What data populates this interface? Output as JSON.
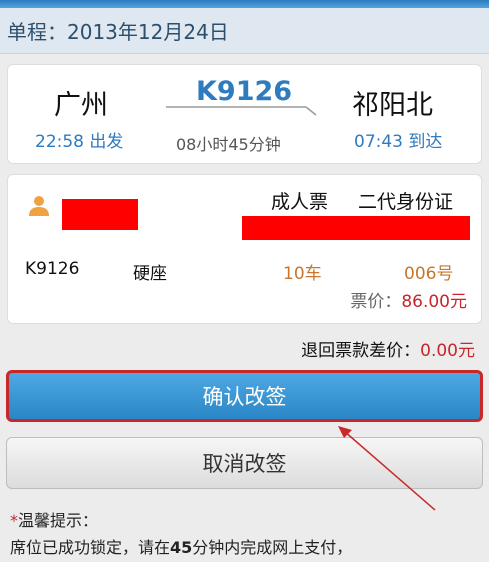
{
  "header": {
    "title": "单程：2013年12月24日"
  },
  "route": {
    "from_city": "广州",
    "to_city": "祁阳北",
    "train_number": "K9126",
    "departure": "22:58 出发",
    "arrival": "07:43 到达",
    "duration": "08小时45分钟"
  },
  "ticket": {
    "ticket_type": "成人票",
    "id_type": "二代身份证",
    "train_code": "K9126",
    "seat_class": "硬座",
    "coach": "10车",
    "seat_number": "006号",
    "price_label": "票价：",
    "price_value": "86.00元"
  },
  "refund": {
    "label": "退回票款差价：",
    "value": "0.00元"
  },
  "buttons": {
    "confirm": "确认改签",
    "cancel": "取消改签"
  },
  "tips": {
    "star": "*",
    "title": "温馨提示：",
    "line_pre": "席位已成功锁定，请在",
    "line_bold": "45",
    "line_post": "分钟内完成网上支付，"
  },
  "colors": {
    "accent_blue": "#2e7bbf",
    "price_red": "#c8262b",
    "coach_orange": "#c8762b",
    "redaction": "#ff0000"
  },
  "icons": {
    "passenger": "person-icon",
    "route_arrow": "arrow-right-icon"
  }
}
